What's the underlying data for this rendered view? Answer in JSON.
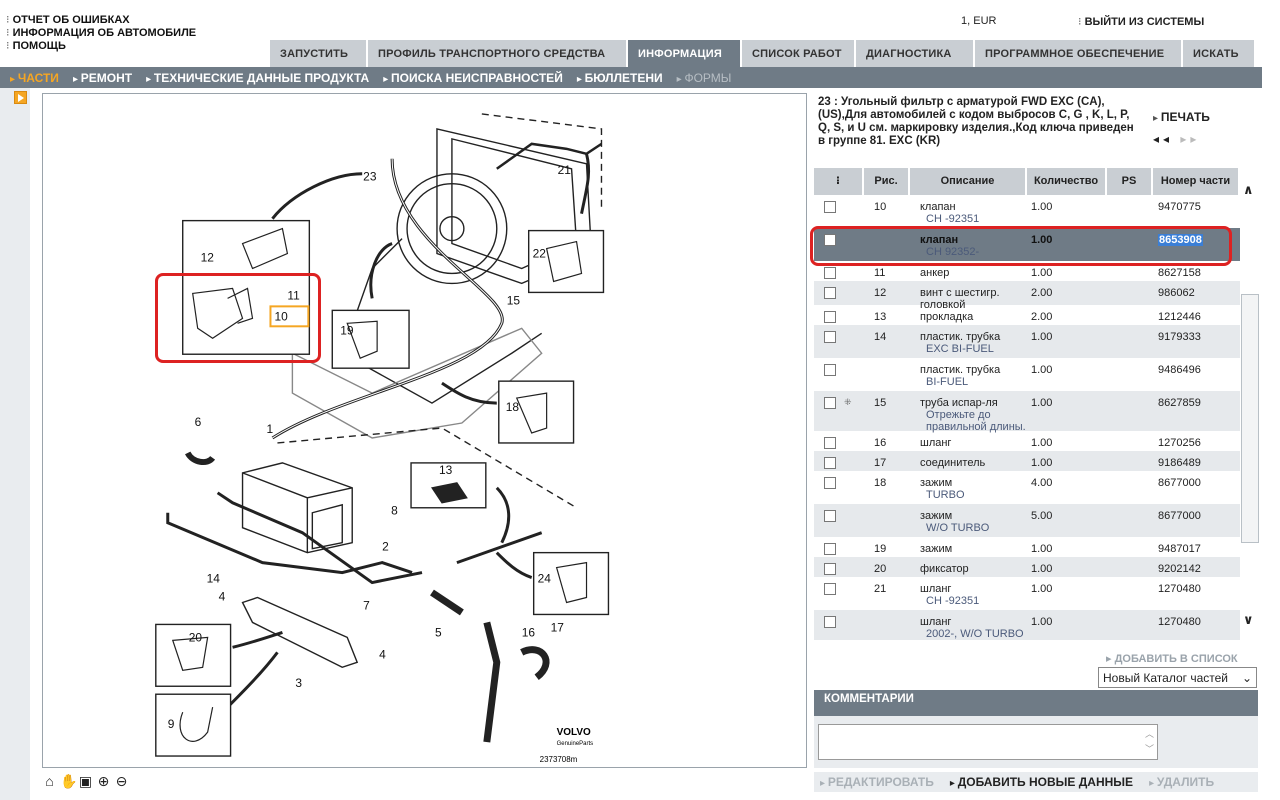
{
  "header": {
    "links": [
      "ОТЧЕТ ОБ ОШИБКАХ",
      "ИНФОРМАЦИЯ ОБ АВТОМОБИЛЕ",
      "ПОМОЩЬ"
    ],
    "user_info": "1, EUR",
    "logout": "ВЫЙТИ ИЗ СИСТЕМЫ"
  },
  "tabs": [
    {
      "label": "ЗАПУСТИТЬ"
    },
    {
      "label": "ПРОФИЛЬ ТРАНСПОРТНОГО СРЕДСТВА"
    },
    {
      "label": "ИНФОРМАЦИЯ",
      "active": true
    },
    {
      "label": "СПИСОК РАБОТ"
    },
    {
      "label": "ДИАГНОСТИКА"
    },
    {
      "label": "ПРОГРАММНОЕ ОБЕСПЕЧЕНИЕ"
    },
    {
      "label": "ИСКАТЬ"
    }
  ],
  "subnav": [
    "ЧАСТИ",
    "РЕМОНТ",
    "ТЕХНИЧЕСКИЕ ДАННЫЕ ПРОДУКТА",
    "ПОИСКА НЕИСПРАВНОСТЕЙ",
    "БЮЛЛЕТЕНИ",
    "ФОРМЫ"
  ],
  "diagram": {
    "brand": "VOLVO",
    "brand_sub": "GenuineParts",
    "drawing_no": "2373708m",
    "callouts": [
      "1",
      "2",
      "3",
      "4",
      "4",
      "6",
      "7",
      "8",
      "9",
      "10",
      "11",
      "12",
      "13",
      "14",
      "15",
      "16",
      "17",
      "18",
      "19",
      "20",
      "21",
      "22",
      "23",
      "24",
      "5"
    ]
  },
  "part_title": "23 : Угольный фильтр с арматурой FWD EXC (CA), (US),Для автомобилей с кодом выбросов C, G , K, L, P, Q, S, и U см. маркировку изделия.,Код ключа приведен в группе 81. EXC (KR)",
  "print_label": "ПЕЧАТЬ",
  "nav_arrows": {
    "prev": "◂◂",
    "next": "▸▸"
  },
  "table": {
    "headers": {
      "fig": "Рис.",
      "desc": "Описание",
      "qty": "Количество",
      "ps": "PS",
      "num": "Номер части"
    },
    "rows": [
      {
        "fig": "10",
        "desc": "клапан",
        "note": "CH -92351",
        "qty": "1.00",
        "num": "9470775"
      },
      {
        "fig": "",
        "desc": "клапан",
        "note": "CH 92352-",
        "qty": "1.00",
        "num": "8653908",
        "selected": true
      },
      {
        "fig": "11",
        "desc": "анкер",
        "note": "",
        "qty": "1.00",
        "num": "8627158"
      },
      {
        "fig": "12",
        "desc": "винт с шестигр. головкой",
        "note": "",
        "qty": "2.00",
        "num": "986062"
      },
      {
        "fig": "13",
        "desc": "прокладка",
        "note": "",
        "qty": "2.00",
        "num": "1212446"
      },
      {
        "fig": "14",
        "desc": "пластик. трубка",
        "note": "EXC BI-FUEL",
        "qty": "1.00",
        "num": "9179333"
      },
      {
        "fig": "",
        "desc": "пластик. трубка",
        "note": "BI-FUEL",
        "qty": "1.00",
        "num": "9486496"
      },
      {
        "fig": "15",
        "desc": "труба испар-ля",
        "note": "Отрежьте до правильной длины.",
        "qty": "1.00",
        "num": "8627859",
        "expand": true
      },
      {
        "fig": "16",
        "desc": "шланг",
        "note": "",
        "qty": "1.00",
        "num": "1270256"
      },
      {
        "fig": "17",
        "desc": "соединитель",
        "note": "",
        "qty": "1.00",
        "num": "9186489"
      },
      {
        "fig": "18",
        "desc": "зажим",
        "note": "TURBO",
        "qty": "4.00",
        "num": "8677000"
      },
      {
        "fig": "",
        "desc": "зажим",
        "note": "W/O TURBO",
        "qty": "5.00",
        "num": "8677000"
      },
      {
        "fig": "19",
        "desc": "зажим",
        "note": "",
        "qty": "1.00",
        "num": "9487017"
      },
      {
        "fig": "20",
        "desc": "фиксатор",
        "note": "",
        "qty": "1.00",
        "num": "9202142"
      },
      {
        "fig": "21",
        "desc": "шланг",
        "note": "CH -92351",
        "qty": "1.00",
        "num": "1270480"
      },
      {
        "fig": "",
        "desc": "шланг",
        "note": "2002-, W/O TURBO",
        "qty": "1.00",
        "num": "1270480"
      }
    ]
  },
  "add_to_list": "ДОБАВИТЬ В СПИСОК",
  "catalog_select": "Новый Каталог частей",
  "comments": {
    "title": "КОММЕНТАРИИ",
    "edit": "РЕДАКТИРОВАТЬ",
    "add": "ДОБАВИТЬ НОВЫЕ ДАННЫЕ",
    "delete": "УДАЛИТЬ"
  },
  "colors": {
    "accent": "#f5a623",
    "bar": "#6f7b86",
    "highlight": "#d22222"
  }
}
